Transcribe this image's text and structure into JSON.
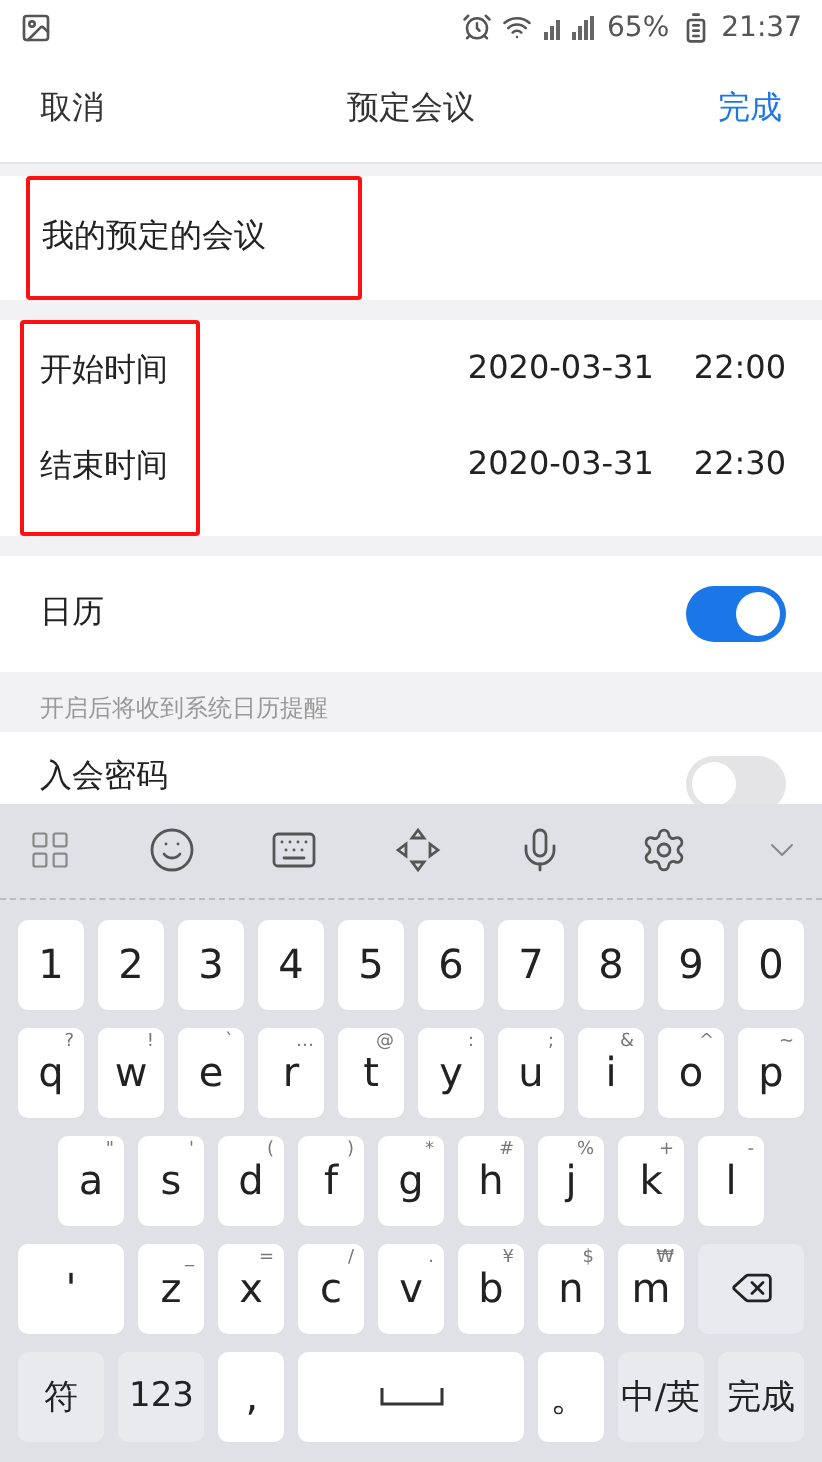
{
  "status_bar": {
    "battery": "65%",
    "time": "21:37"
  },
  "header": {
    "cancel": "取消",
    "title": "预定会议",
    "done": "完成"
  },
  "title_field": {
    "value": "我的预定的会议",
    "highlighted": true
  },
  "times": {
    "highlighted": true,
    "rows": [
      {
        "label": "开始时间",
        "date": "2020-03-31",
        "time": "22:00"
      },
      {
        "label": "结束时间",
        "date": "2020-03-31",
        "time": "22:30"
      }
    ]
  },
  "settings": [
    {
      "label": "日历",
      "on": true,
      "hint": "开启后将收到系统日历提醒"
    },
    {
      "label": "入会密码",
      "on": false
    }
  ],
  "keyboard": {
    "rows": [
      [
        {
          "kind": "char",
          "label": "1"
        },
        {
          "kind": "char",
          "label": "2"
        },
        {
          "kind": "char",
          "label": "3"
        },
        {
          "kind": "char",
          "label": "4"
        },
        {
          "kind": "char",
          "label": "5"
        },
        {
          "kind": "char",
          "label": "6"
        },
        {
          "kind": "char",
          "label": "7"
        },
        {
          "kind": "char",
          "label": "8"
        },
        {
          "kind": "char",
          "label": "9"
        },
        {
          "kind": "char",
          "label": "0"
        }
      ],
      [
        {
          "kind": "char",
          "label": "q",
          "hint": "?"
        },
        {
          "kind": "char",
          "label": "w",
          "hint": "!"
        },
        {
          "kind": "char",
          "label": "e",
          "hint": "`"
        },
        {
          "kind": "char",
          "label": "r",
          "hint": "…"
        },
        {
          "kind": "char",
          "label": "t",
          "hint": "@"
        },
        {
          "kind": "char",
          "label": "y",
          "hint": ":"
        },
        {
          "kind": "char",
          "label": "u",
          "hint": ";"
        },
        {
          "kind": "char",
          "label": "i",
          "hint": "&"
        },
        {
          "kind": "char",
          "label": "o",
          "hint": "^"
        },
        {
          "kind": "char",
          "label": "p",
          "hint": "~"
        }
      ],
      [
        {
          "kind": "char",
          "label": "a",
          "hint": "\""
        },
        {
          "kind": "char",
          "label": "s",
          "hint": "'"
        },
        {
          "kind": "char",
          "label": "d",
          "hint": "("
        },
        {
          "kind": "char",
          "label": "f",
          "hint": ")"
        },
        {
          "kind": "char",
          "label": "g",
          "hint": "*"
        },
        {
          "kind": "char",
          "label": "h",
          "hint": "#"
        },
        {
          "kind": "char",
          "label": "j",
          "hint": "%"
        },
        {
          "kind": "char",
          "label": "k",
          "hint": "+"
        },
        {
          "kind": "char",
          "label": "l",
          "hint": "-"
        }
      ],
      [
        {
          "kind": "wide",
          "label": "'"
        },
        {
          "kind": "char",
          "label": "z",
          "hint": "_"
        },
        {
          "kind": "char",
          "label": "x",
          "hint": "="
        },
        {
          "kind": "char",
          "label": "c",
          "hint": "/"
        },
        {
          "kind": "char",
          "label": "v",
          "hint": "."
        },
        {
          "kind": "char",
          "label": "b",
          "hint": "¥"
        },
        {
          "kind": "char",
          "label": "n",
          "hint": "$"
        },
        {
          "kind": "char",
          "label": "m",
          "hint": "₩"
        },
        {
          "kind": "backspace"
        }
      ]
    ],
    "bottom_row": [
      {
        "kind": "function",
        "label": "符"
      },
      {
        "kind": "function",
        "label": "123"
      },
      {
        "kind": "char",
        "label": ","
      },
      {
        "kind": "space"
      },
      {
        "kind": "char",
        "label": "。"
      },
      {
        "kind": "function",
        "label": "中/英"
      },
      {
        "kind": "function",
        "label": "完成"
      }
    ]
  }
}
